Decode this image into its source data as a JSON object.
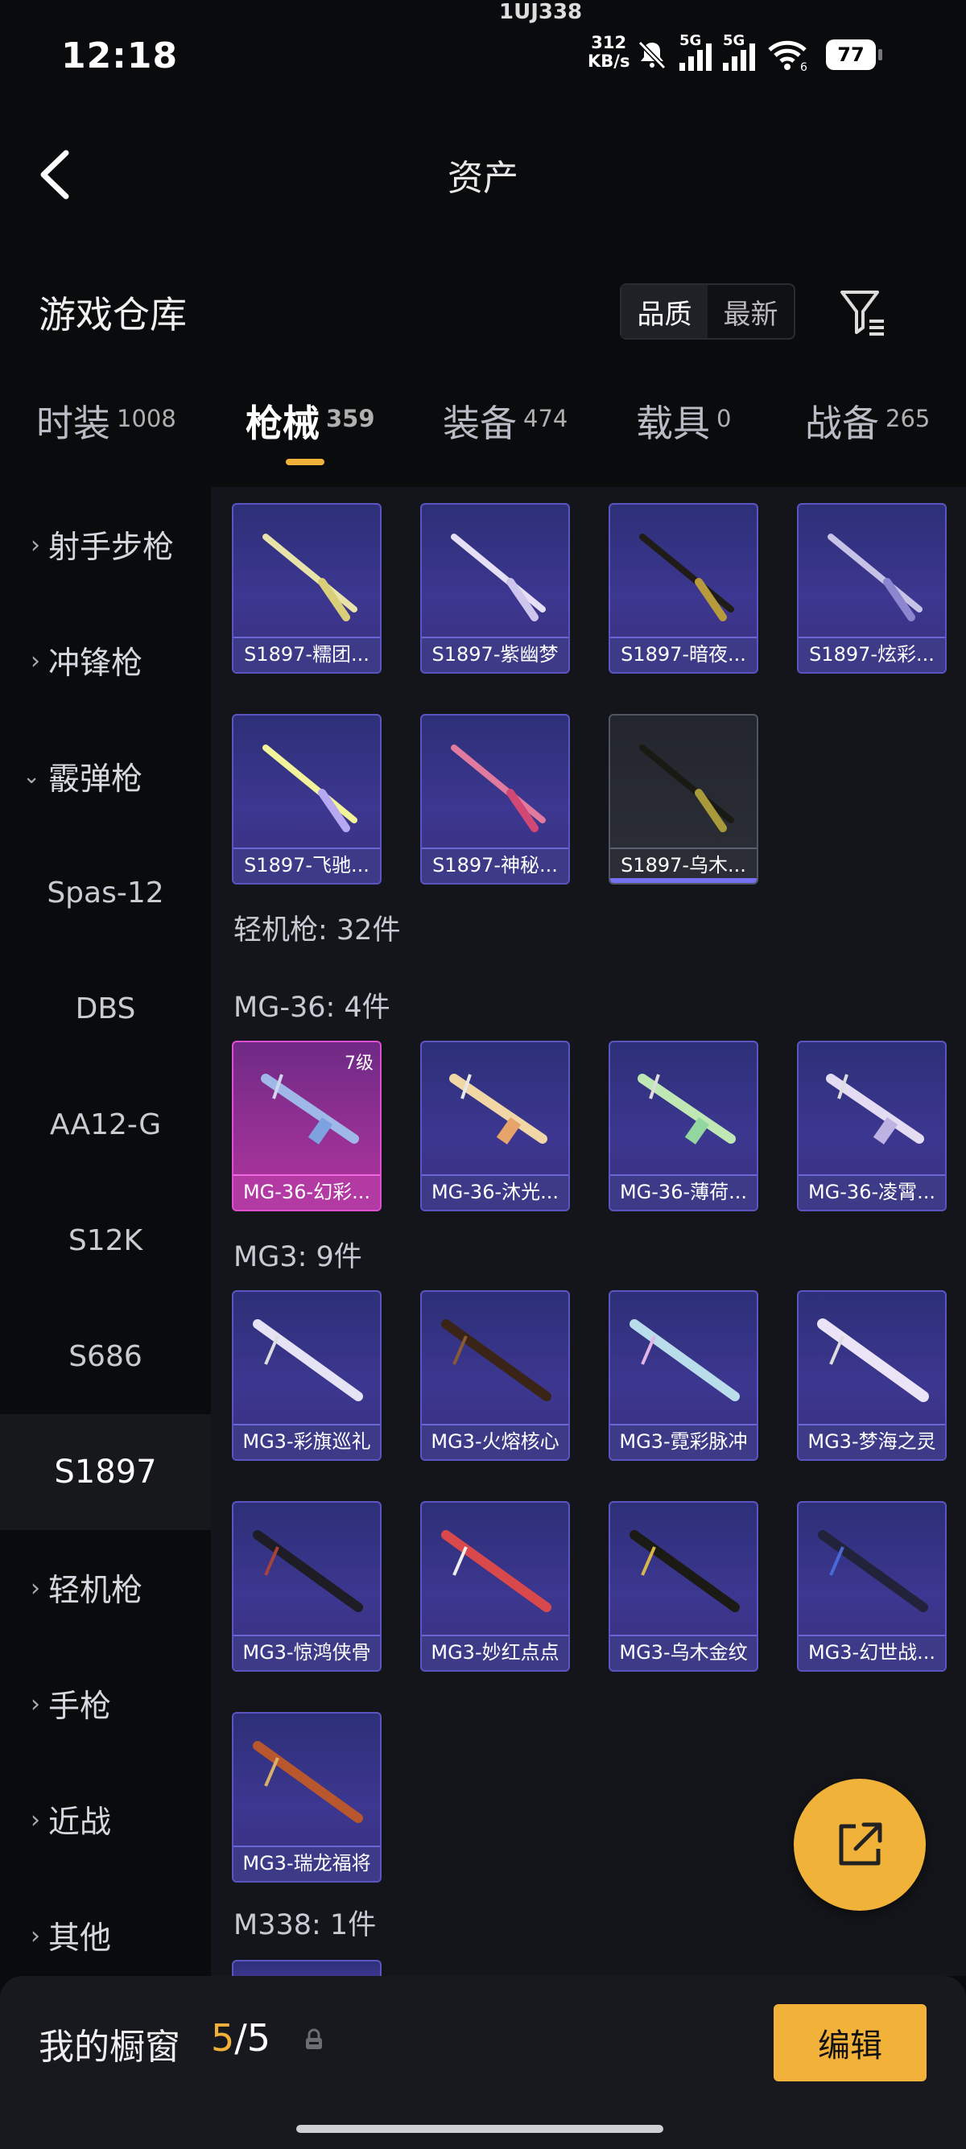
{
  "status_bar": {
    "time": "12:18",
    "speed_value": "312",
    "speed_unit": "KB/s",
    "sig1_label": "5G",
    "sig2_label": "5G",
    "wifi_label": "6",
    "battery": "77",
    "top_crumb": "1UJ338"
  },
  "header": {
    "title": "资产",
    "section_title": "游戏仓库",
    "sort_quality": "品质",
    "sort_newest": "最新"
  },
  "tabs": [
    {
      "label": "时装",
      "count": "1008"
    },
    {
      "label": "枪械",
      "count": "359"
    },
    {
      "label": "装备",
      "count": "474"
    },
    {
      "label": "载具",
      "count": "0"
    },
    {
      "label": "战备",
      "count": "265"
    }
  ],
  "sidebar": {
    "items": [
      {
        "label": "射手步枪"
      },
      {
        "label": "冲锋枪"
      },
      {
        "label": "霰弹枪"
      },
      {
        "label": "Spas-12"
      },
      {
        "label": "DBS"
      },
      {
        "label": "AA12-G"
      },
      {
        "label": "S12K"
      },
      {
        "label": "S686"
      },
      {
        "label": "S1897"
      },
      {
        "label": "轻机枪"
      },
      {
        "label": "手枪"
      },
      {
        "label": "近战"
      },
      {
        "label": "其他"
      }
    ]
  },
  "main": {
    "s1897": [
      "S1897-糯团...",
      "S1897-紫幽梦",
      "S1897-暗夜...",
      "S1897-炫彩...",
      "S1897-飞驰...",
      "S1897-神秘...",
      "S1897-乌木..."
    ],
    "lmg_header": "轻机枪: 32件",
    "mg36_header": "MG-36: 4件",
    "mg36": [
      {
        "name": "MG-36-幻彩...",
        "level": "7级"
      },
      {
        "name": "MG-36-沐光..."
      },
      {
        "name": "MG-36-薄荷..."
      },
      {
        "name": "MG-36-凌霄..."
      }
    ],
    "mg3_header": "MG3: 9件",
    "mg3": [
      "MG3-彩旗巡礼",
      "MG3-火熔核心",
      "MG3-霓彩脉冲",
      "MG3-梦海之灵",
      "MG3-惊鸿侠骨",
      "MG3-妙红点点",
      "MG3-乌木金纹",
      "MG3-幻世战...",
      "MG3-瑞龙福将"
    ],
    "m338_header": "M338: 1件"
  },
  "bottom": {
    "label": "我的橱窗",
    "current": "5",
    "sep_total": "/5",
    "edit": "编辑"
  },
  "colors": {
    "accent": "#f0b13a",
    "card_purple": "#3c3790",
    "card_pink": "#b3359f",
    "background": "#0a0b0d"
  }
}
